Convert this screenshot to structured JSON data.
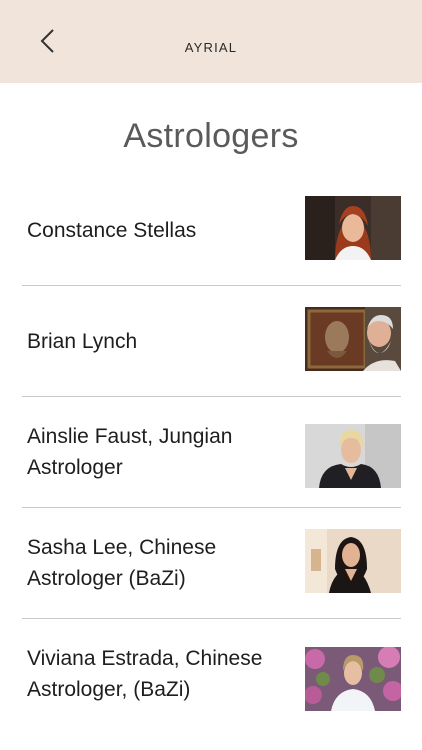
{
  "header": {
    "back_icon": "chevron-left-icon",
    "title": "AYRIAL",
    "background": "#f1e4da"
  },
  "page": {
    "title": "Astrologers"
  },
  "astrologers": [
    {
      "name": "Constance Stellas",
      "photo": "portrait-red-hair-woman"
    },
    {
      "name": "Brian Lynch",
      "photo": "portrait-white-beard-man-with-painting"
    },
    {
      "name": "Ainslie Faust, Jungian Astrologer",
      "photo": "portrait-blonde-woman"
    },
    {
      "name": "Sasha Lee, Chinese Astrologer (BaZi)",
      "photo": "portrait-dark-hair-woman"
    },
    {
      "name": "Viviana Estrada, Chinese Astrologer, (BaZi)",
      "photo": "portrait-woman-with-pink-flowers"
    }
  ]
}
